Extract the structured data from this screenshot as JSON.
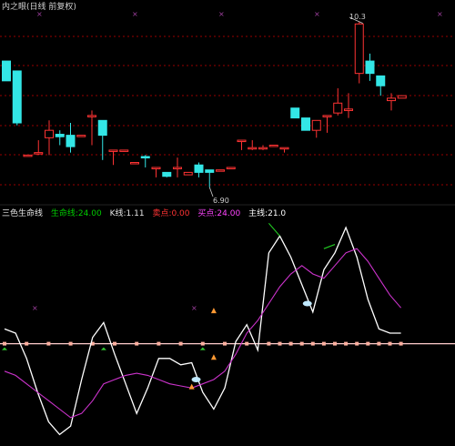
{
  "title": "内之眼(日线 前复权)",
  "price_high_label": "10.3",
  "price_low_label": "6.90",
  "indicator": {
    "name": "三色生命线",
    "items": [
      {
        "label": "生命线:24.00",
        "color": "#00cc00"
      },
      {
        "label": "K线:1.11",
        "color": "#e6e6e6"
      },
      {
        "label": "卖点:0.00",
        "color": "#ff3333"
      },
      {
        "label": "买点:24.00",
        "color": "#ff44ff"
      },
      {
        "label": "主线:21.0",
        "color": "#ffffff"
      }
    ]
  },
  "colors": {
    "up": "#ff3333",
    "down": "#33e6e6",
    "grid": "#990000",
    "white_line": "#ffffff",
    "magenta_line": "#cc33cc",
    "green_line": "#22cc22",
    "level_line": "#ffcccc"
  },
  "chart_data": [
    {
      "type": "candlestick",
      "y_range": [
        6.6,
        10.5
      ],
      "candles": [
        {
          "o": 9.45,
          "h": 9.45,
          "l": 9.05,
          "c": 9.05
        },
        {
          "o": 9.25,
          "h": 9.25,
          "l": 8.15,
          "c": 8.2
        },
        {
          "o": 7.55,
          "h": 7.55,
          "l": 7.55,
          "c": 7.55
        },
        {
          "o": 7.6,
          "h": 7.85,
          "l": 7.55,
          "c": 7.6
        },
        {
          "o": 7.9,
          "h": 8.25,
          "l": 7.55,
          "c": 8.05
        },
        {
          "o": 7.97,
          "h": 8.05,
          "l": 7.75,
          "c": 7.92
        },
        {
          "o": 7.95,
          "h": 8.2,
          "l": 7.6,
          "c": 7.72
        },
        {
          "o": 7.95,
          "h": 7.95,
          "l": 7.95,
          "c": 7.95
        },
        {
          "o": 8.35,
          "h": 8.45,
          "l": 7.75,
          "c": 8.35
        },
        {
          "o": 8.25,
          "h": 8.25,
          "l": 7.45,
          "c": 7.95
        },
        {
          "o": 7.65,
          "h": 7.65,
          "l": 7.35,
          "c": 7.65
        },
        {
          "o": 7.65,
          "h": 7.65,
          "l": 7.65,
          "c": 7.65
        },
        {
          "o": 7.4,
          "h": 7.4,
          "l": 7.4,
          "c": 7.4
        },
        {
          "o": 7.52,
          "h": 7.55,
          "l": 7.3,
          "c": 7.5
        },
        {
          "o": 7.3,
          "h": 7.3,
          "l": 7.1,
          "c": 7.3
        },
        {
          "o": 7.2,
          "h": 7.2,
          "l": 7.1,
          "c": 7.12
        },
        {
          "o": 7.3,
          "h": 7.5,
          "l": 7.1,
          "c": 7.3
        },
        {
          "o": 7.15,
          "h": 7.2,
          "l": 7.15,
          "c": 7.2
        },
        {
          "o": 7.35,
          "h": 7.4,
          "l": 7.1,
          "c": 7.2
        },
        {
          "o": 7.25,
          "h": 7.25,
          "l": 6.9,
          "c": 7.2
        },
        {
          "o": 7.25,
          "h": 7.25,
          "l": 7.25,
          "c": 7.25
        },
        {
          "o": 7.3,
          "h": 7.3,
          "l": 7.3,
          "c": 7.3
        },
        {
          "o": 7.85,
          "h": 7.85,
          "l": 7.65,
          "c": 7.85
        },
        {
          "o": 7.7,
          "h": 7.85,
          "l": 7.65,
          "c": 7.7
        },
        {
          "o": 7.7,
          "h": 7.75,
          "l": 7.65,
          "c": 7.7
        },
        {
          "o": 7.75,
          "h": 7.75,
          "l": 7.75,
          "c": 7.75
        },
        {
          "o": 7.7,
          "h": 7.7,
          "l": 7.6,
          "c": 7.7
        },
        {
          "o": 8.5,
          "h": 8.5,
          "l": 8.3,
          "c": 8.3
        },
        {
          "o": 8.3,
          "h": 8.3,
          "l": 8.05,
          "c": 8.05
        },
        {
          "o": 8.05,
          "h": 8.25,
          "l": 7.9,
          "c": 8.25
        },
        {
          "o": 8.35,
          "h": 8.35,
          "l": 8.0,
          "c": 8.35
        },
        {
          "o": 8.4,
          "h": 8.9,
          "l": 8.35,
          "c": 8.6
        },
        {
          "o": 8.45,
          "h": 8.8,
          "l": 8.3,
          "c": 8.48
        },
        {
          "o": 9.2,
          "h": 10.25,
          "l": 9.0,
          "c": 10.2
        },
        {
          "o": 9.45,
          "h": 9.6,
          "l": 9.05,
          "c": 9.2
        },
        {
          "o": 9.15,
          "h": 9.15,
          "l": 8.75,
          "c": 8.95
        },
        {
          "o": 8.65,
          "h": 8.8,
          "l": 8.45,
          "c": 8.7
        },
        {
          "o": 8.7,
          "h": 8.75,
          "l": 8.7,
          "c": 8.75
        }
      ]
    },
    {
      "type": "line",
      "y_range": [
        0,
        100
      ],
      "series": [
        {
          "color": "white",
          "values": [
            52,
            50,
            38,
            22,
            8,
            2,
            6,
            28,
            48,
            55,
            40,
            26,
            12,
            24,
            38,
            38,
            35,
            36,
            22,
            14,
            24,
            46,
            54,
            42,
            88,
            96,
            86,
            73,
            60,
            80,
            88,
            100,
            86,
            66,
            52,
            50,
            50
          ]
        },
        {
          "color": "magenta",
          "values": [
            32,
            30,
            26,
            22,
            18,
            14,
            10,
            12,
            18,
            26,
            28,
            30,
            31,
            30,
            28,
            26,
            25,
            24,
            26,
            28,
            32,
            40,
            50,
            56,
            64,
            72,
            78,
            82,
            78,
            76,
            82,
            88,
            90,
            84,
            76,
            68,
            62
          ]
        },
        {
          "color": "green",
          "values": [
            null,
            null,
            null,
            null,
            null,
            null,
            null,
            null,
            null,
            null,
            null,
            null,
            null,
            null,
            null,
            null,
            null,
            null,
            null,
            null,
            null,
            null,
            null,
            null,
            null,
            96,
            null,
            null,
            null,
            null,
            null,
            null,
            null,
            null,
            null,
            null,
            null
          ]
        }
      ],
      "level": 45
    }
  ]
}
